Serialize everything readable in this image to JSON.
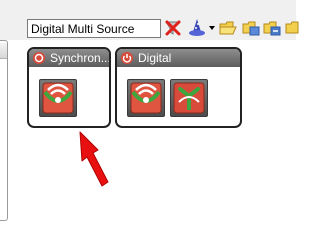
{
  "toolbar": {
    "search_value": "Digital Multi Source",
    "icons": [
      "clear-filter-icon",
      "wizard-icon",
      "folder-icon",
      "group-add-icon",
      "group-remove-icon",
      "group-settings-icon"
    ]
  },
  "groups": [
    {
      "title": "Synchron...",
      "icon": "synchronize-group-icon",
      "tiles": [
        "signal-source-icon"
      ]
    },
    {
      "title": "Digital",
      "icon": "digital-group-icon",
      "tiles": [
        "signal-source-icon",
        "digital-recorder-icon"
      ]
    }
  ],
  "colors": {
    "group_header": "#6e6e6e",
    "tile_green": "#3fa63f",
    "tile_red": "#e05540",
    "arrow_red": "#e81010"
  }
}
